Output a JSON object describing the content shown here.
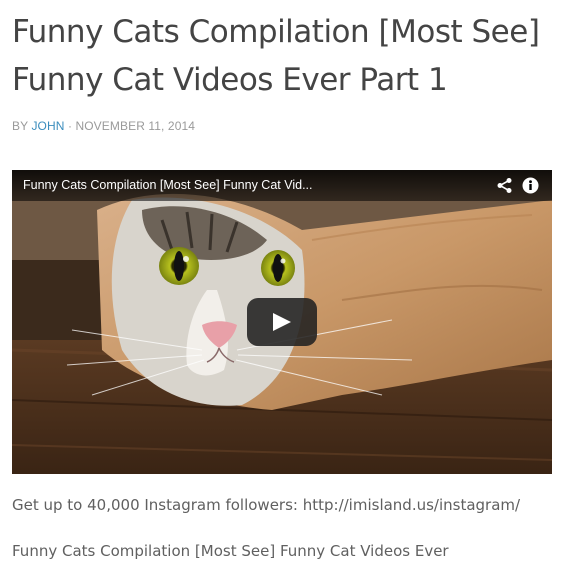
{
  "post": {
    "title_line1": "Funny Cats Compilation [Most See]",
    "title_line2": "Funny Cat Videos Ever Part 1",
    "byline_prefix": "BY ",
    "author": "JOHN",
    "byline_sep": " · ",
    "date": "NOVEMBER 11, 2014"
  },
  "video": {
    "title": "Funny Cats Compilation [Most See] Funny Cat Vid...",
    "share_icon": "share-icon",
    "info_icon": "info-icon",
    "play_icon": "play-icon"
  },
  "body": {
    "paragraph_1": "Get up to 40,000 Instagram followers: http://imisland.us/instagram/",
    "paragraph_2": "Funny Cats Compilation [Most See] Funny Cat Videos Ever"
  },
  "colors": {
    "title": "#444444",
    "author_link": "#3b8dbd",
    "meta": "#9a9a9a",
    "text": "#606060"
  }
}
